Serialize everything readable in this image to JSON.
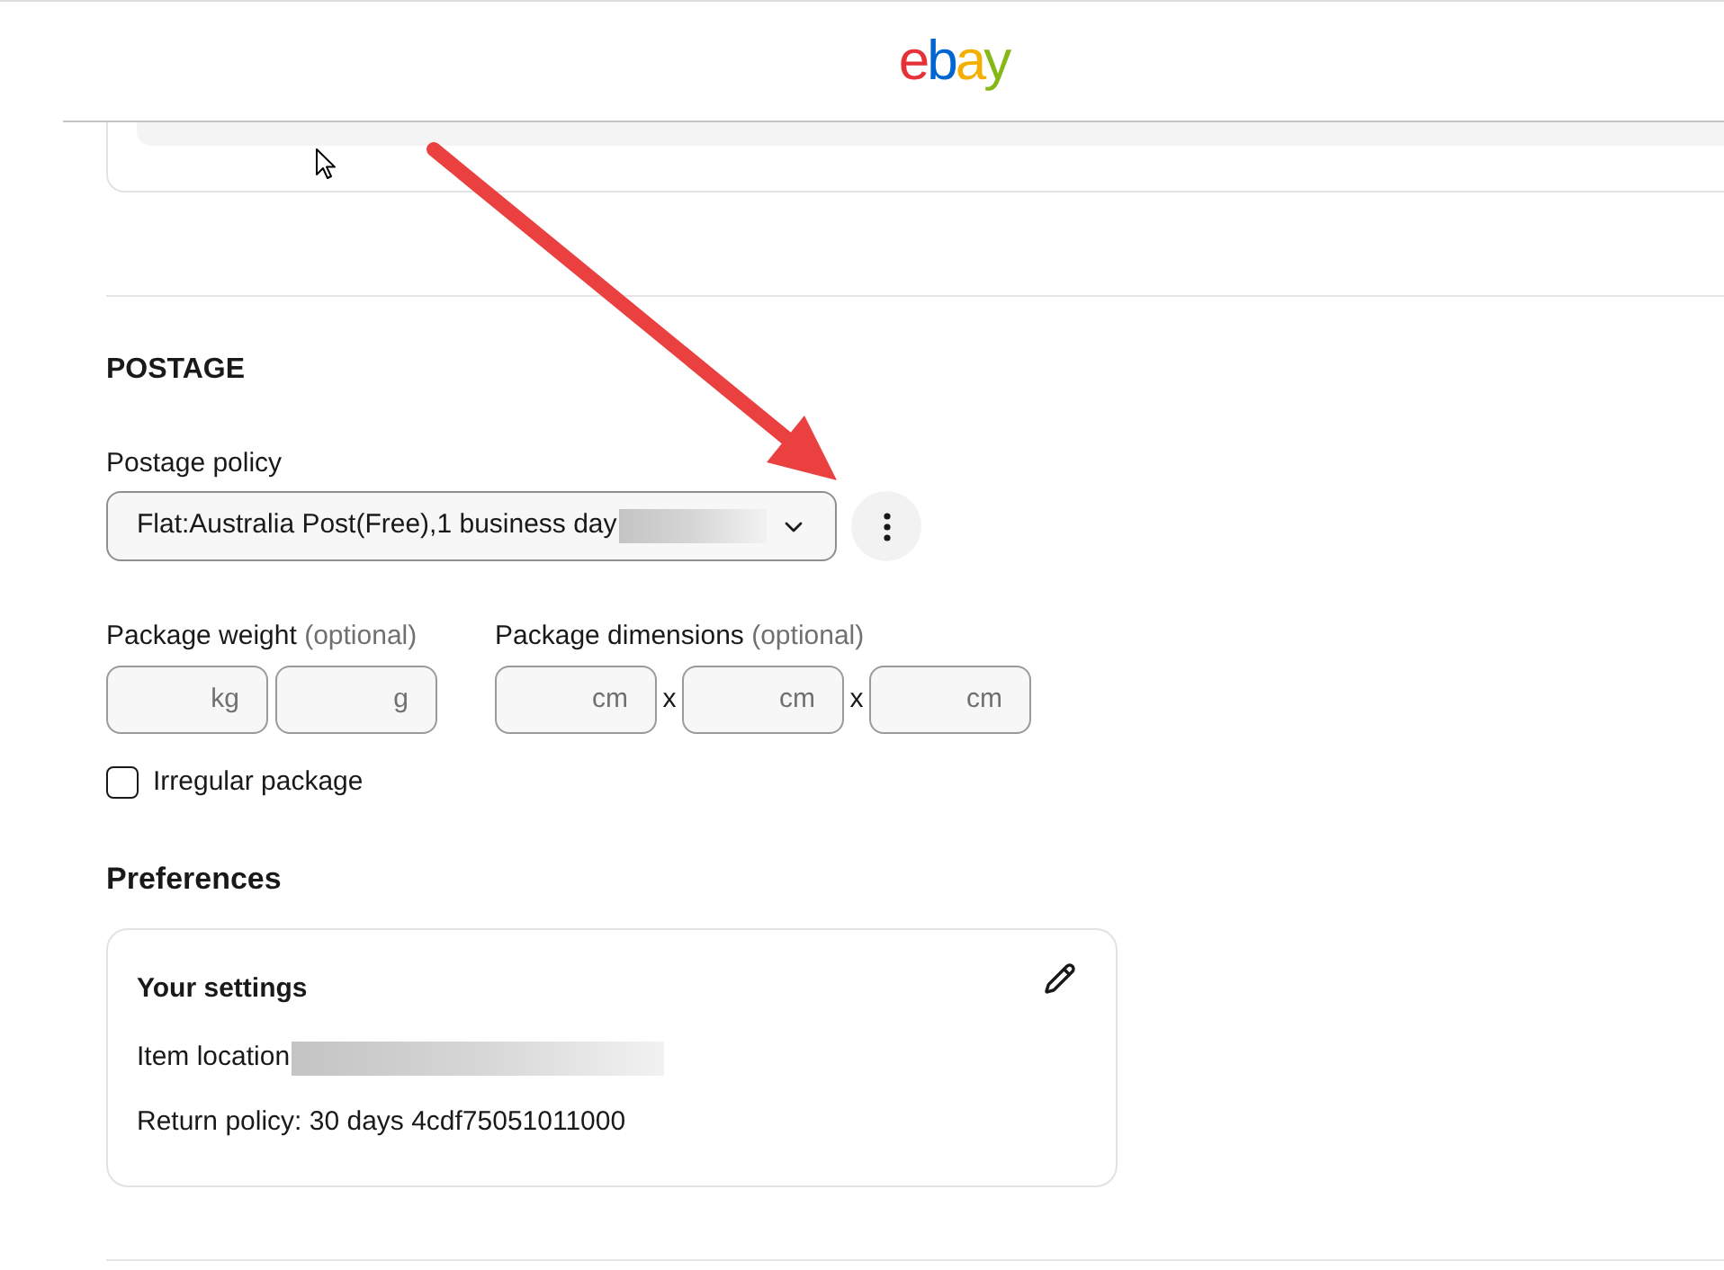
{
  "header": {
    "logo": [
      {
        "char": "e",
        "color": "#e53238"
      },
      {
        "char": "b",
        "color": "#0064d2"
      },
      {
        "char": "a",
        "color": "#f5af02"
      },
      {
        "char": "y",
        "color": "#86b817"
      }
    ]
  },
  "postage": {
    "title": "POSTAGE",
    "policy_label": "Postage policy",
    "policy_value": "Flat:Australia Post(Free),1 business day",
    "weight": {
      "label": "Package weight",
      "optional": "(optional)",
      "fields": [
        {
          "unit": "kg"
        },
        {
          "unit": "g"
        }
      ]
    },
    "dimensions": {
      "label": "Package dimensions",
      "optional": "(optional)",
      "fields": [
        {
          "unit": "cm"
        },
        {
          "unit": "cm"
        },
        {
          "unit": "cm"
        }
      ],
      "separators": [
        "x",
        "x"
      ]
    },
    "irregular": {
      "label": "Irregular package",
      "checked": false
    }
  },
  "preferences": {
    "title": "Preferences",
    "card": {
      "title": "Your settings",
      "rows": [
        "Item location",
        "Return policy: 30 days 4cdf75051011000"
      ]
    }
  }
}
